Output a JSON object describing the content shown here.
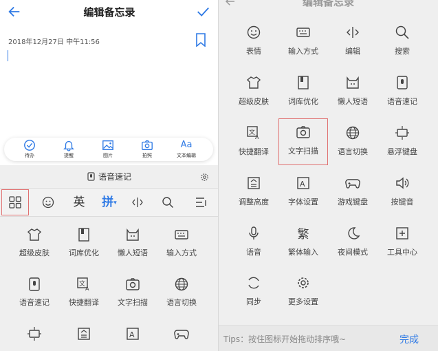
{
  "header": {
    "title": "编辑备忘录"
  },
  "note": {
    "date": "2018年12月27日 中午11:56"
  },
  "toolbar": {
    "items": [
      {
        "label": "待办",
        "icon": "check-circle-icon"
      },
      {
        "label": "提醒",
        "icon": "bell-icon"
      },
      {
        "label": "图片",
        "icon": "image-icon"
      },
      {
        "label": "拍照",
        "icon": "camera-icon"
      },
      {
        "label": "文本编辑",
        "icon": "text-edit-icon",
        "glyph": "Aa"
      }
    ]
  },
  "ime": {
    "voice_bar": "语音速记",
    "keys": {
      "english": "英",
      "pinyin": "拼"
    },
    "panel_items": [
      "超级皮肤",
      "词库优化",
      "懒人短语",
      "输入方式",
      "语音速记",
      "快捷翻译",
      "文字扫描",
      "语言切换"
    ]
  },
  "right": {
    "title": "编辑备忘录",
    "items": [
      "表情",
      "输入方式",
      "编辑",
      "搜索",
      "超级皮肤",
      "词库优化",
      "懒人短语",
      "语音速记",
      "快捷翻译",
      "文字扫描",
      "语言切换",
      "悬浮键盘",
      "调整高度",
      "字体设置",
      "游戏键盘",
      "按键音",
      "语音",
      "繁体输入",
      "夜间模式",
      "工具中心",
      "同步",
      "更多设置"
    ],
    "fan_glyph": "繁",
    "tips": "Tips：按住图标开始拖动排序哦~",
    "done": "完成"
  },
  "colors": {
    "accent": "#2f7ae5",
    "highlight": "#e07070"
  }
}
